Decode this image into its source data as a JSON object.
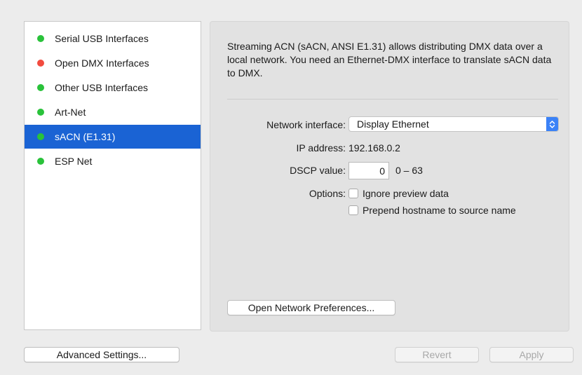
{
  "sidebar": {
    "items": [
      {
        "label": "Serial USB Interfaces",
        "status_color": "#29c23a",
        "selected": false
      },
      {
        "label": "Open DMX Interfaces",
        "status_color": "#f24b3f",
        "selected": false
      },
      {
        "label": "Other USB Interfaces",
        "status_color": "#29c23a",
        "selected": false
      },
      {
        "label": "Art-Net",
        "status_color": "#29c23a",
        "selected": false
      },
      {
        "label": "sACN (E1.31)",
        "status_color": "#29c23a",
        "selected": true
      },
      {
        "label": "ESP Net",
        "status_color": "#29c23a",
        "selected": false
      }
    ]
  },
  "panel": {
    "description": "Streaming ACN (sACN, ANSI E1.31) allows distributing DMX data over a local network. You need an Ethernet-DMX interface to translate sACN data to DMX.",
    "network_interface_label": "Network interface:",
    "network_interface_value": "Display Ethernet",
    "ip_address_label": "IP address:",
    "ip_address_value": "192.168.0.2",
    "dscp_label": "DSCP value:",
    "dscp_value": "0",
    "dscp_range": "0 – 63",
    "options_label": "Options:",
    "options": [
      {
        "label": "Ignore preview data",
        "checked": false
      },
      {
        "label": "Prepend hostname to source name",
        "checked": false
      }
    ],
    "open_network_prefs_label": "Open Network Preferences..."
  },
  "footer": {
    "advanced_settings_label": "Advanced Settings...",
    "revert_label": "Revert",
    "apply_label": "Apply"
  },
  "colors": {
    "selection": "#1a63d4",
    "status_green": "#29c23a",
    "status_red": "#f24b3f",
    "select_arrow": "#3b82f7"
  }
}
